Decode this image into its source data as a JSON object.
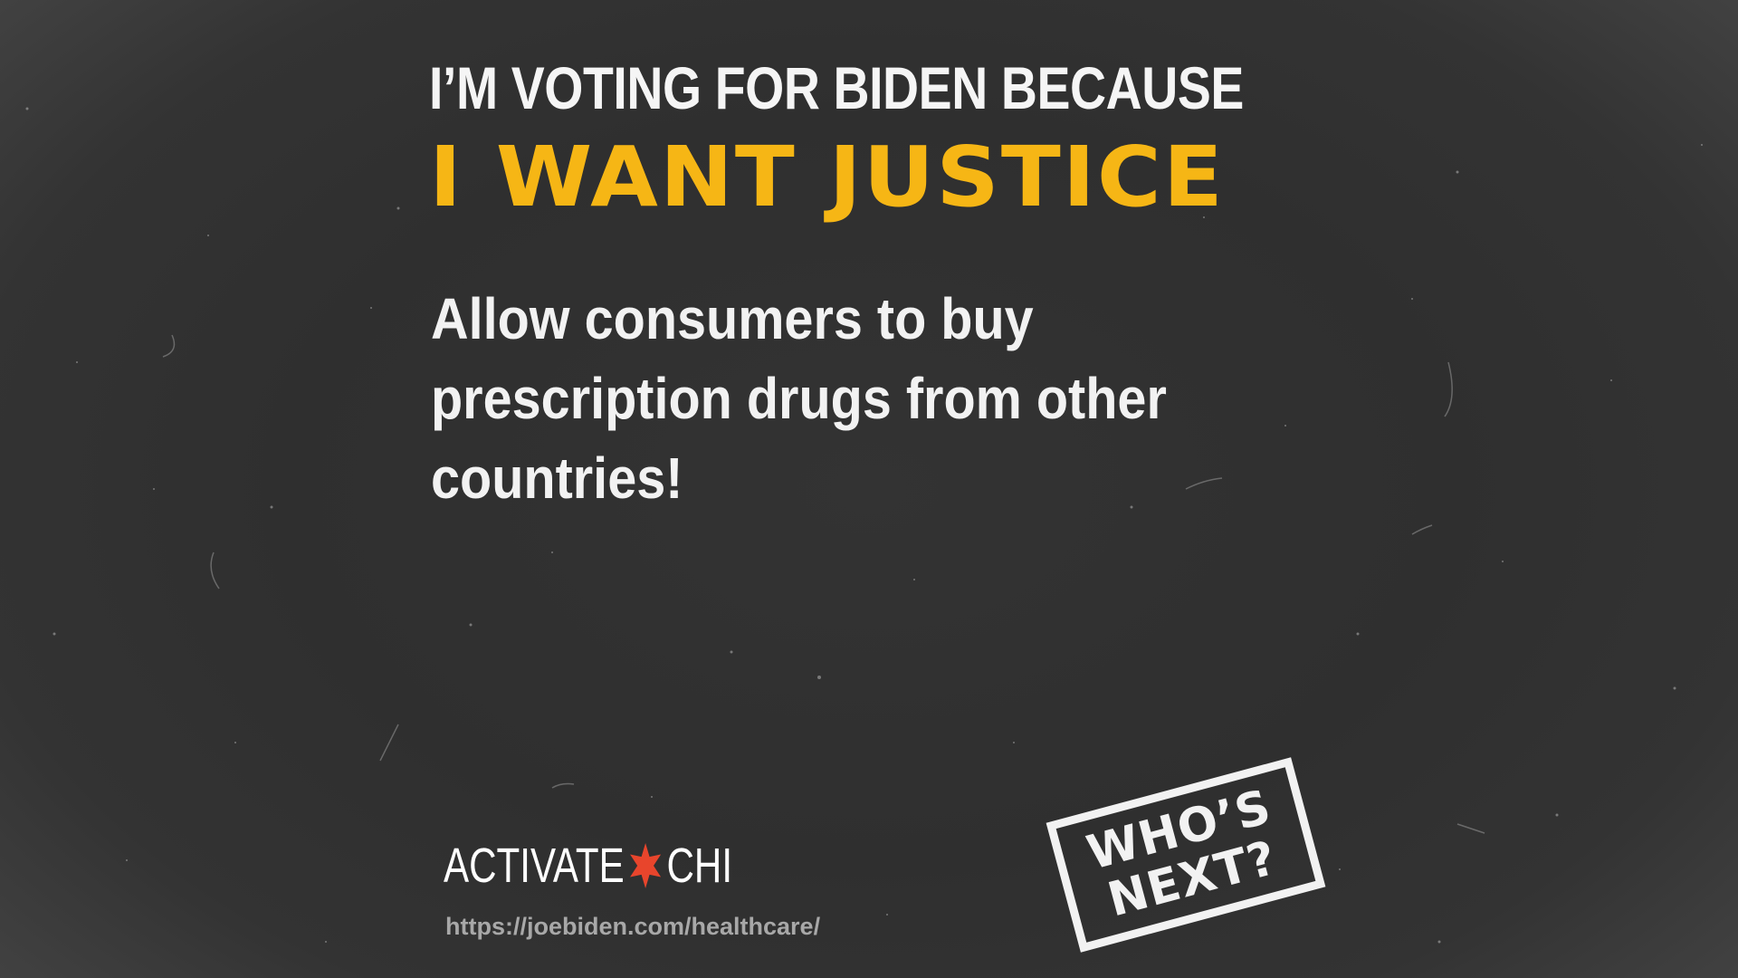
{
  "poster": {
    "headline": "I’M VOTING FOR BIDEN BECAUSE",
    "subhead": "I WANT JUSTICE",
    "body_lines": [
      "Allow consumers to buy",
      "prescription drugs from other",
      "countries!"
    ]
  },
  "logo": {
    "left_text": "ACTIVATE",
    "right_text": "CHI",
    "star_icon": "six-point-star-icon",
    "star_color": "#e8452c"
  },
  "footer": {
    "url": "https://joebiden.com/healthcare/"
  },
  "stamp": {
    "line1": "WHO’S",
    "line2": "NEXT?"
  },
  "colors": {
    "background": "#2f2f2f",
    "accent": "#f6b615",
    "text": "#f2f2f2",
    "url_text": "#a8a8a8"
  }
}
